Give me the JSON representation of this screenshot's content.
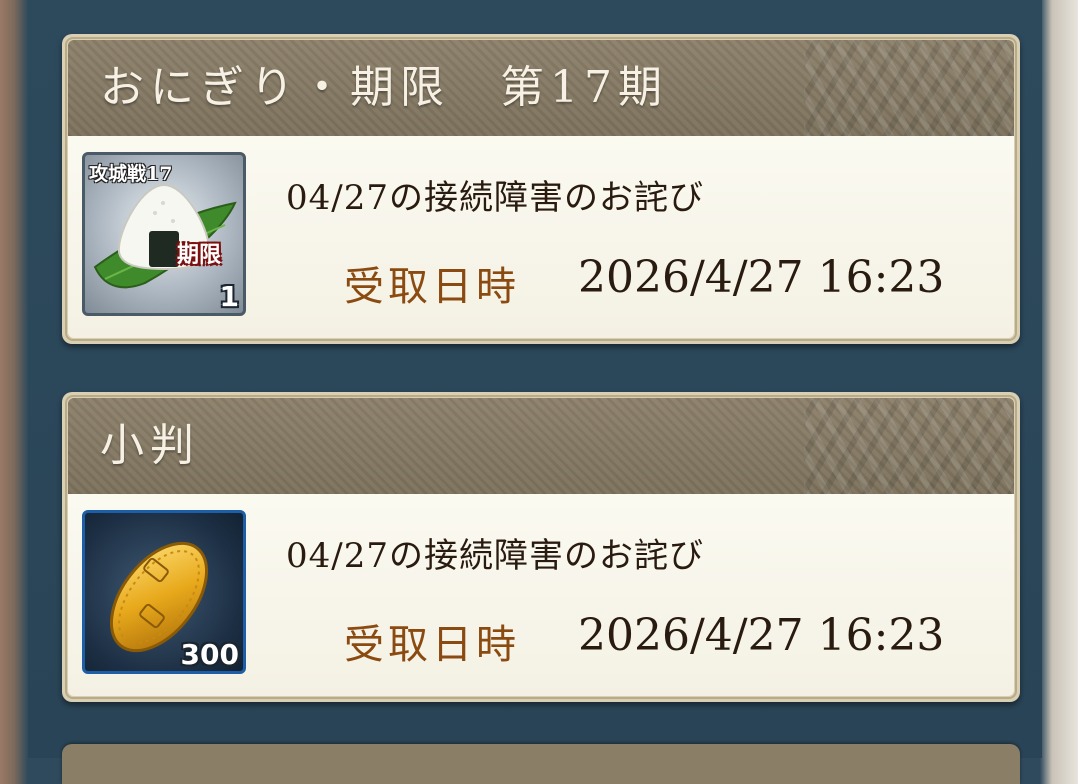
{
  "mail_items": [
    {
      "title": "おにぎり・期限　第17期",
      "icon": {
        "type": "onigiri-icon",
        "label": "攻城戦17",
        "badge": "期限",
        "quantity": "1"
      },
      "message": "04/27の接続障害のお詫び",
      "received_label": "受取日時",
      "received_at": "2026/4/27 16:23"
    },
    {
      "title": "小判",
      "icon": {
        "type": "koban-icon",
        "quantity": "300"
      },
      "message": "04/27の接続障害のお詫び",
      "received_label": "受取日時",
      "received_at": "2026/4/27 16:23"
    }
  ]
}
